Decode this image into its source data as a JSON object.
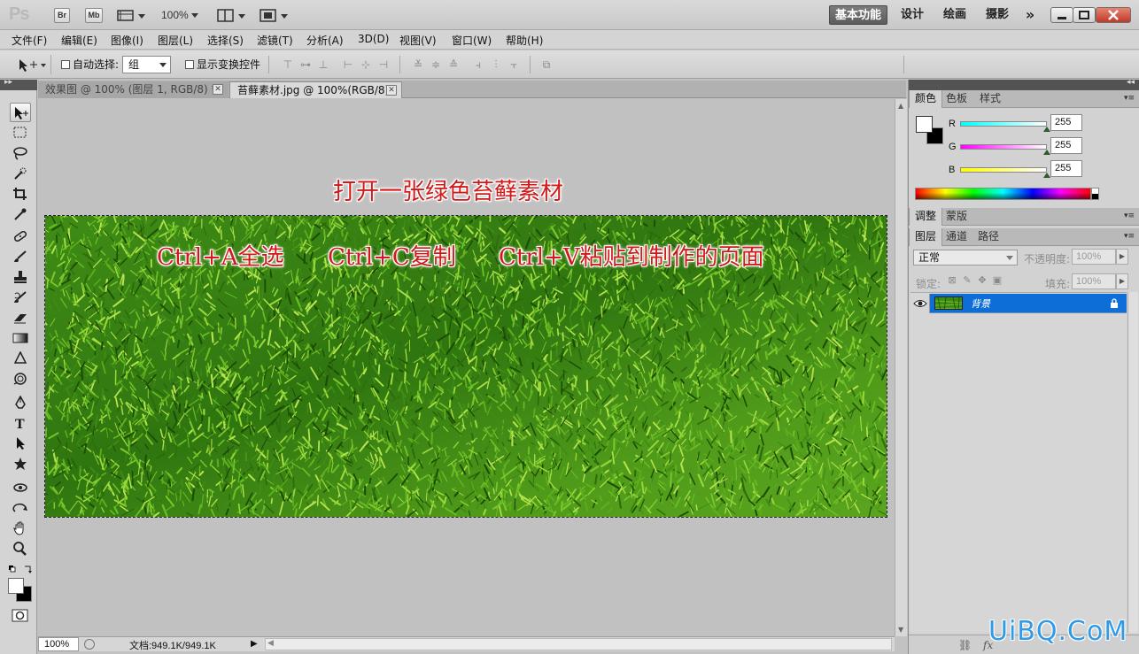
{
  "app": {
    "logo": "Ps",
    "bridge_btn": "Br",
    "minibridge_btn": "Mb",
    "zoom_level": "100%",
    "workspaces": [
      "基本功能",
      "设计",
      "绘画",
      "摄影"
    ],
    "more_workspaces": "»"
  },
  "menu": {
    "items": [
      "文件(F)",
      "编辑(E)",
      "图像(I)",
      "图层(L)",
      "选择(S)",
      "滤镜(T)",
      "分析(A)",
      "3D(D)",
      "视图(V)",
      "窗口(W)",
      "帮助(H)"
    ]
  },
  "options": {
    "auto_select_label": "自动选择:",
    "auto_select_checked": false,
    "auto_select_value": "组",
    "show_transform_label": "显示变换控件",
    "show_transform_checked": false
  },
  "documents": {
    "tabs": [
      {
        "label": "效果图 @ 100% (图层 1, RGB/8) *",
        "active": false
      },
      {
        "label": "苔藓素材.jpg @ 100%(RGB/8)",
        "active": true
      }
    ]
  },
  "canvas": {
    "annotation_title": "打开一张绿色苔藓素材",
    "annotation_step1": "Ctrl+A全选",
    "annotation_step2": "Ctrl+C复制",
    "annotation_step3": "Ctrl+V粘贴到制作的页面",
    "annotation_color": "#d01a1a"
  },
  "status": {
    "zoom": "100%",
    "doc_info": "文档:949.1K/949.1K"
  },
  "color_panel": {
    "tabs": [
      "颜色",
      "色板",
      "样式"
    ],
    "channels": [
      {
        "label": "R",
        "value": "255"
      },
      {
        "label": "G",
        "value": "255"
      },
      {
        "label": "B",
        "value": "255"
      }
    ]
  },
  "adjust_panel": {
    "tabs": [
      "调整",
      "蒙版"
    ]
  },
  "layers_panel": {
    "tabs": [
      "图层",
      "通道",
      "路径"
    ],
    "blend_mode": "正常",
    "opacity_label": "不透明度:",
    "opacity_value": "100%",
    "lock_label": "锁定:",
    "fill_label": "填充:",
    "fill_value": "100%",
    "layers": [
      {
        "name": "背景",
        "visible": true,
        "locked": true,
        "selected": true
      }
    ],
    "selected_color": "#0c6ed6"
  },
  "watermark": "UiBQ.CoM"
}
